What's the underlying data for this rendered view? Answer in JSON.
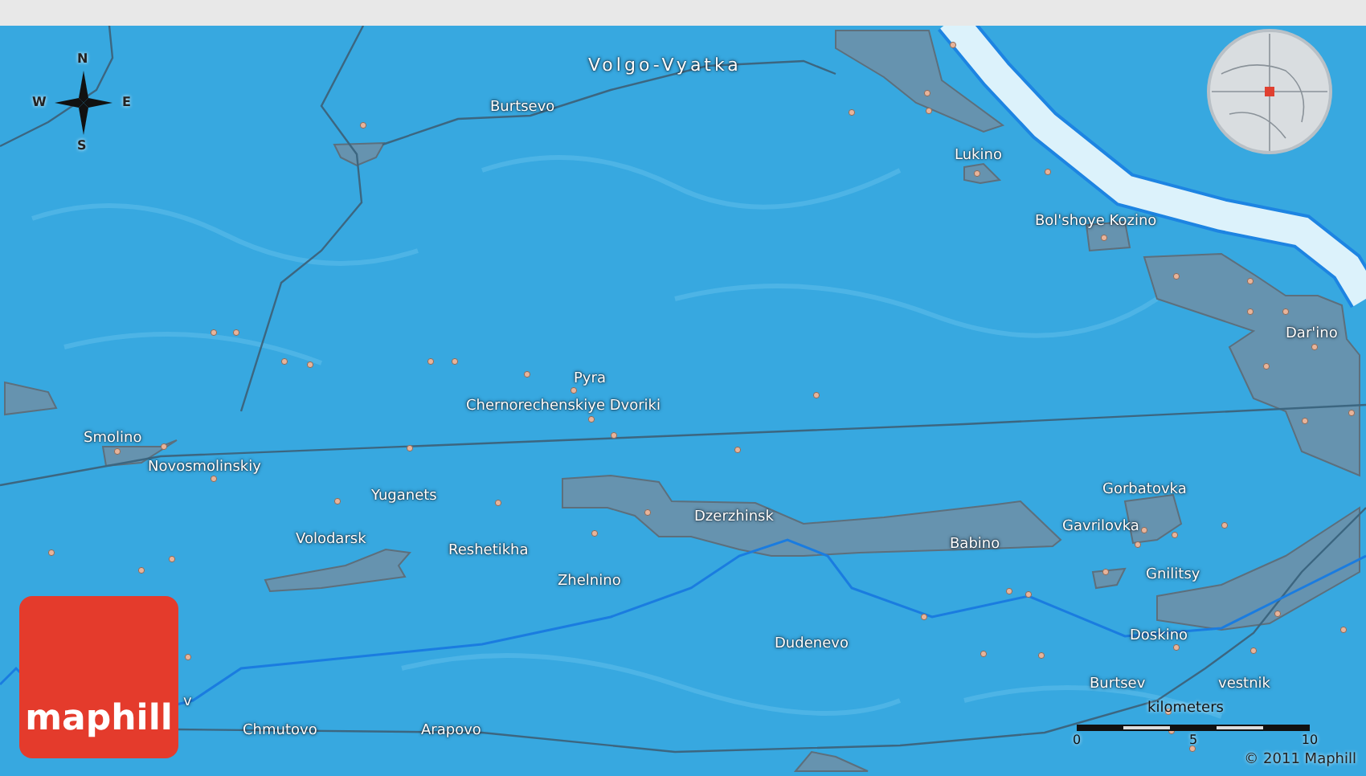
{
  "map": {
    "region_label": "Volgo-Vyatka",
    "places": [
      {
        "name": "Burtsevo"
      },
      {
        "name": "Lukino"
      },
      {
        "name": "Bol'shoye Kozino"
      },
      {
        "name": "Dar'ino"
      },
      {
        "name": "Pyra"
      },
      {
        "name": "Chernorechenskiye Dvoriki"
      },
      {
        "name": "Smolino"
      },
      {
        "name": "Novosmolinskiy"
      },
      {
        "name": "Yuganets"
      },
      {
        "name": "Dzerzhinsk"
      },
      {
        "name": "Gorbatovka"
      },
      {
        "name": "Volodarsk"
      },
      {
        "name": "Reshetikha"
      },
      {
        "name": "Gavrilovka"
      },
      {
        "name": "Babino"
      },
      {
        "name": "Gnilitsy"
      },
      {
        "name": "Zhelnino"
      },
      {
        "name": "Doskino"
      },
      {
        "name": "Dudenevo"
      },
      {
        "name": "v"
      },
      {
        "name": "Burtsev"
      },
      {
        "name": "vestnik"
      },
      {
        "name": "Chmutovo"
      },
      {
        "name": "Arapovo"
      }
    ],
    "compass": {
      "north": "N",
      "west": "W",
      "east": "E",
      "south": "S"
    },
    "scale": {
      "unit": "kilometers",
      "ticks": [
        "0",
        "5",
        "10"
      ]
    },
    "logo": "maphill",
    "copyright": "© 2011 Maphill"
  }
}
